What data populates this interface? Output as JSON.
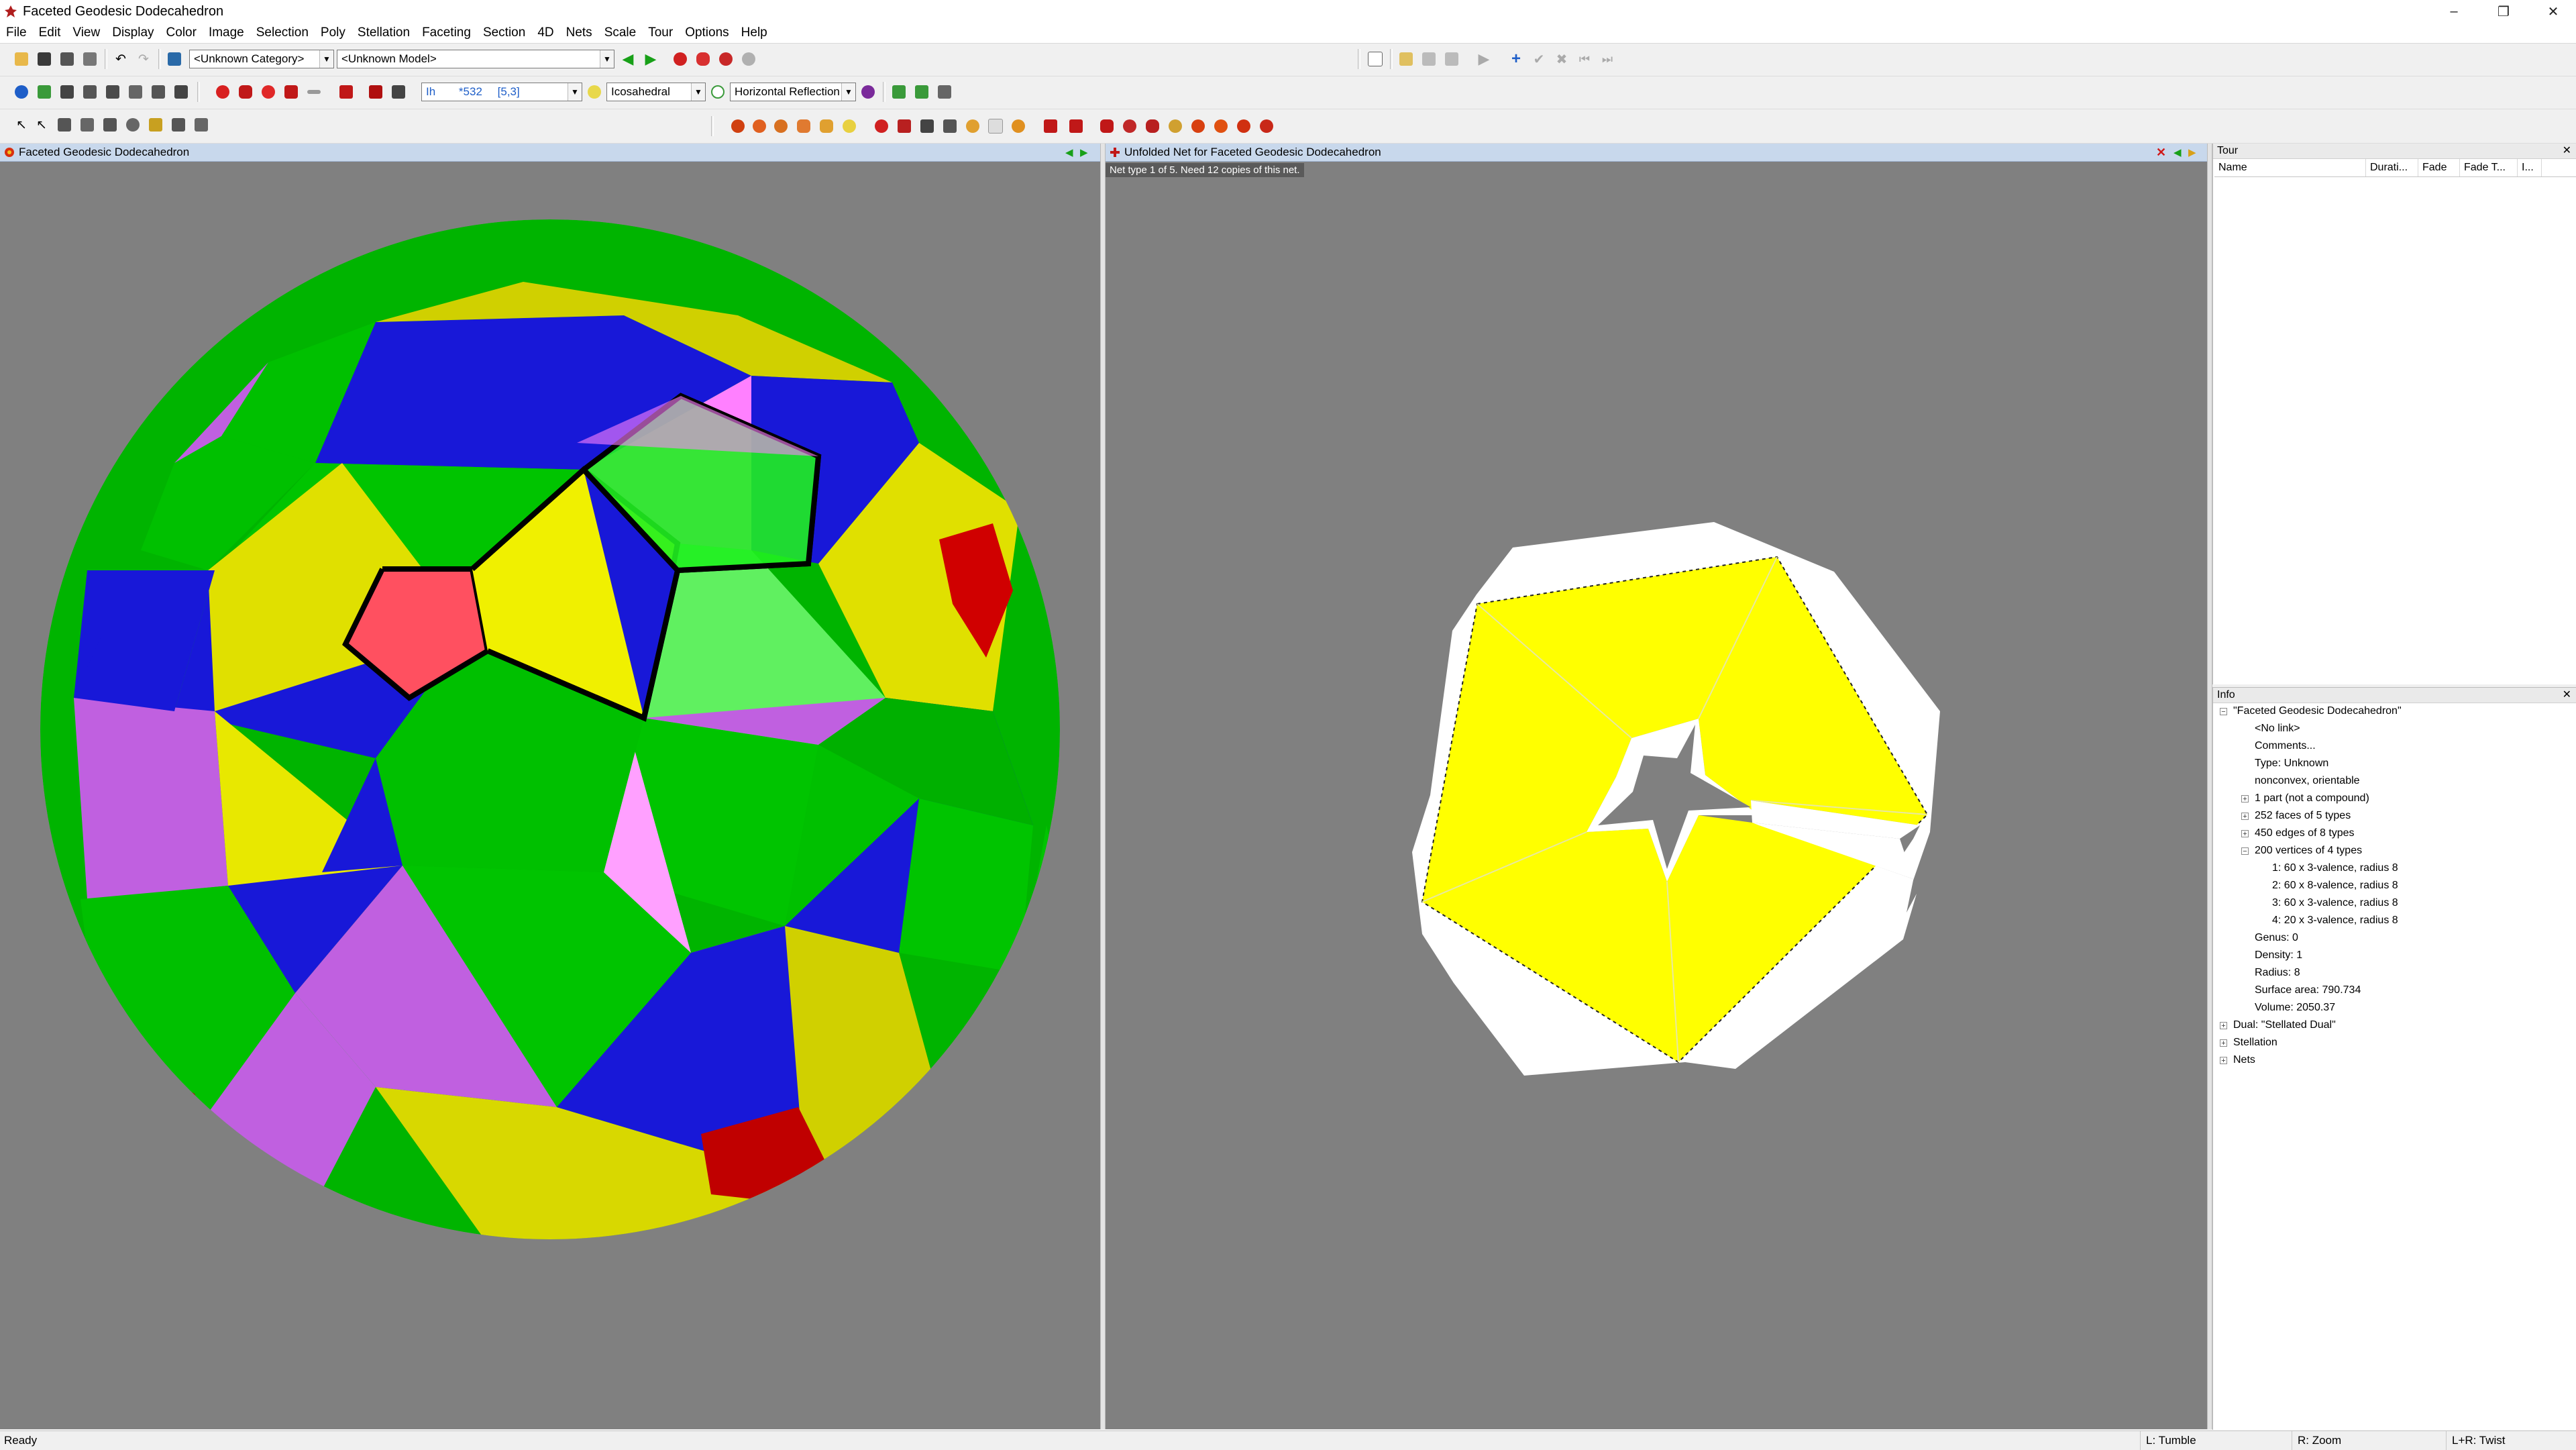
{
  "window": {
    "title": "Faceted Geodesic Dodecahedron",
    "controls": [
      "–",
      "❐",
      "✕"
    ]
  },
  "menu": [
    "File",
    "Edit",
    "View",
    "Display",
    "Color",
    "Image",
    "Selection",
    "Poly",
    "Stellation",
    "Faceting",
    "Section",
    "4D",
    "Nets",
    "Scale",
    "Tour",
    "Options",
    "Help"
  ],
  "toolbar1": {
    "category_value": "<Unknown Category>",
    "model_value": "<Unknown Model>"
  },
  "toolbar2": {
    "symmetry_prefix": "Ih",
    "count_value": "*532",
    "schlafli_value": "[5,3]",
    "group_value": "Icosahedral",
    "reflection_value": "Horizontal Reflection"
  },
  "colors": {
    "pane_header": "#c8d8ec",
    "viewport": "#808080",
    "yellow": "#e8e800",
    "green": "#00c400",
    "blue": "#1515d8",
    "violet": "#c060e0",
    "red": "#ff5050"
  },
  "left_pane": {
    "title": "Faceted Geodesic Dodecahedron"
  },
  "right_pane": {
    "title": "Unfolded Net for Faceted Geodesic Dodecahedron",
    "tooltip": "Net type 1 of 5.  Need 12 copies of this net."
  },
  "tour": {
    "title": "Tour",
    "columns": [
      "Name",
      "Durati...",
      "Fade",
      "Fade T...",
      "I..."
    ]
  },
  "info": {
    "title": "Info",
    "root": "\"Faceted Geodesic Dodecahedron\"",
    "items": [
      {
        "text": "<No link>",
        "level": 1,
        "expander": ""
      },
      {
        "text": "Comments...",
        "level": 1,
        "expander": ""
      },
      {
        "text": "Type: Unknown",
        "level": 1,
        "expander": ""
      },
      {
        "text": "nonconvex, orientable",
        "level": 1,
        "expander": ""
      },
      {
        "text": "1 part (not a compound)",
        "level": 1,
        "expander": "+"
      },
      {
        "text": "252 faces of 5 types",
        "level": 1,
        "expander": "+"
      },
      {
        "text": "450 edges of 8 types",
        "level": 1,
        "expander": "+"
      },
      {
        "text": "200 vertices of 4 types",
        "level": 1,
        "expander": "-"
      },
      {
        "text": "1: 60 x 3-valence, radius 8",
        "level": 2,
        "expander": ""
      },
      {
        "text": "2: 60 x 8-valence, radius 8",
        "level": 2,
        "expander": ""
      },
      {
        "text": "3: 60 x 3-valence, radius 8",
        "level": 2,
        "expander": ""
      },
      {
        "text": "4: 20 x 3-valence, radius 8",
        "level": 2,
        "expander": ""
      },
      {
        "text": "Genus: 0",
        "level": 1,
        "expander": ""
      },
      {
        "text": "Density: 1",
        "level": 1,
        "expander": ""
      },
      {
        "text": "Radius: 8",
        "level": 1,
        "expander": ""
      },
      {
        "text": "Surface area: 790.734",
        "level": 1,
        "expander": ""
      },
      {
        "text": "Volume: 2050.37",
        "level": 1,
        "expander": ""
      },
      {
        "text": "Dual: \"Stellated Dual\"",
        "level": 0,
        "expander": "+"
      },
      {
        "text": "Stellation",
        "level": 0,
        "expander": "+"
      },
      {
        "text": "Nets",
        "level": 0,
        "expander": "+"
      }
    ]
  },
  "status": {
    "left": "Ready",
    "tumble": "L: Tumble",
    "zoom": "R: Zoom",
    "twist": "L+R: Twist"
  }
}
